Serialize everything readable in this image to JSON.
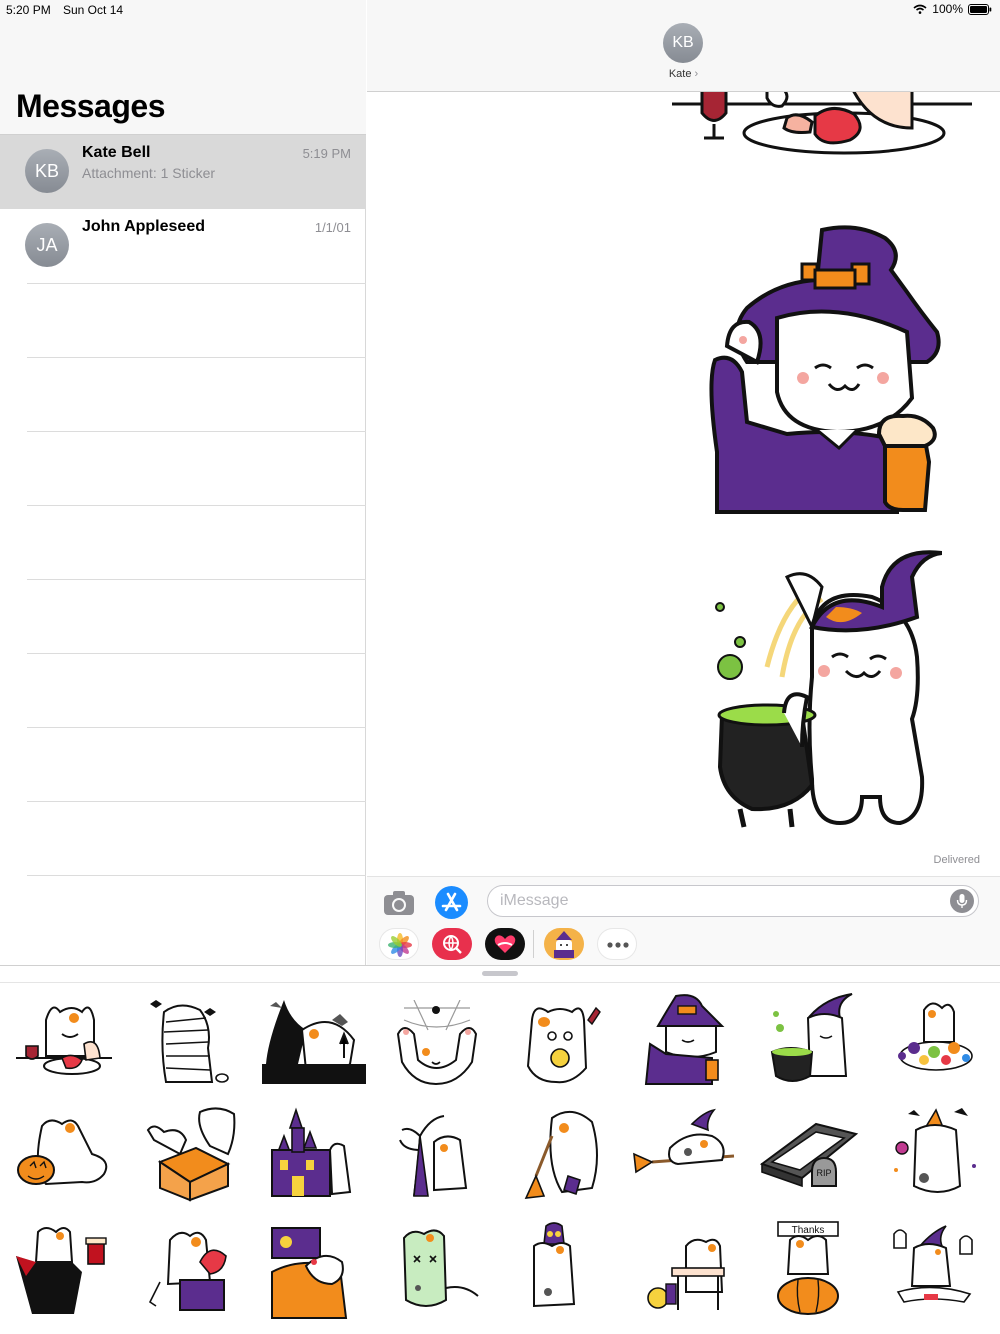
{
  "status_bar": {
    "time": "5:20 PM",
    "date": "Sun Oct 14",
    "battery": "100%"
  },
  "sidebar": {
    "title": "Messages",
    "conversations": [
      {
        "initials": "KB",
        "name": "Kate Bell",
        "preview": "Attachment: 1 Sticker",
        "time": "5:19 PM",
        "selected": true
      },
      {
        "initials": "JA",
        "name": "John Appleseed",
        "preview": "",
        "time": "1/1/01",
        "selected": false
      }
    ]
  },
  "chat": {
    "contact_initials": "KB",
    "contact_name": "Kate",
    "chevron": "›",
    "delivered": "Delivered",
    "input_placeholder": "iMessage"
  },
  "app_drawer": [
    "photos-icon",
    "search-web-icon",
    "digital-touch-icon",
    "sticker-app-icon",
    "more-icon"
  ],
  "sticker_panel": {
    "stickers": [
      "vampire-cat-dinner",
      "mummy-cat",
      "silhouette-cat-bats",
      "spider-web-cat",
      "ghost-cat-skull",
      "witch-cat-beer",
      "witch-cat-cauldron",
      "cat-candy-pile",
      "cat-pumpkin-ghost",
      "cat-box-ghost",
      "haunted-house-cat",
      "witch-cat-tree",
      "cat-broom-ghost",
      "flying-broom-cat",
      "coffin-cat",
      "party-cat-bats",
      "dracula-cat-beer",
      "cat-gift-box",
      "sleeping-cat-moon",
      "zombie-cat",
      "owl-on-cat",
      "cat-skull-table",
      "thanks-pumpkin-cat",
      "witch-cat-ghosts"
    ],
    "thanks_text": "Thanks",
    "rip_text": "RIP"
  },
  "colors": {
    "accent": "#1b8cff",
    "purple": "#5b2d8e",
    "orange": "#f28c1c",
    "selection": "#d9d9d9"
  }
}
